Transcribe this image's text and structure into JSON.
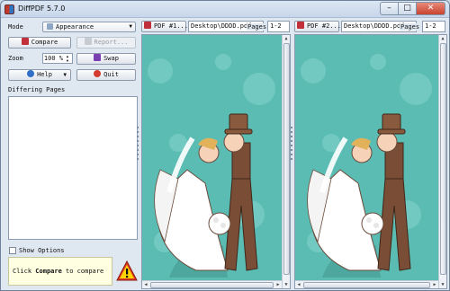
{
  "window": {
    "title": "DiffPDF 5.7.0",
    "min_glyph": "–",
    "max_glyph": "□",
    "close_glyph": "✕"
  },
  "left": {
    "mode_label": "Mode",
    "mode_value": "Appearance",
    "compare_label": "Compare",
    "report_label": "Report...",
    "zoom_label": "Zoom",
    "zoom_value": "100 %",
    "swap_label": "Swap",
    "help_label": "Help",
    "quit_label": "Quit",
    "differing_pages_label": "Differing Pages",
    "show_options_label": "Show Options",
    "show_options_checked": false,
    "status_prefix": "Click ",
    "status_bold": "Compare",
    "status_suffix": " to compare",
    "dropdown_arrow": "▼",
    "spin_up": "▲",
    "spin_down": "▼"
  },
  "panels": [
    {
      "button_label": "PDF #1...",
      "file_path": "Desktop\\DDDD.pdf",
      "pages_label": "Pages",
      "pages_value": "1-2"
    },
    {
      "button_label": "PDF #2...",
      "file_path": "Desktop\\DDDD.pdf",
      "pages_label": "Pages",
      "pages_value": "1-2"
    }
  ],
  "scroll_up": "▲",
  "scroll_down": "▼",
  "scroll_left": "◀",
  "scroll_right": "▶",
  "colors": {
    "teal_page": "#5bbcb4",
    "compare_icon": "#c1303a",
    "swap_icon": "#7a3fb0",
    "help_icon": "#2f6fc8",
    "quit_icon": "#d43c2f",
    "warning": "#e23b22"
  }
}
